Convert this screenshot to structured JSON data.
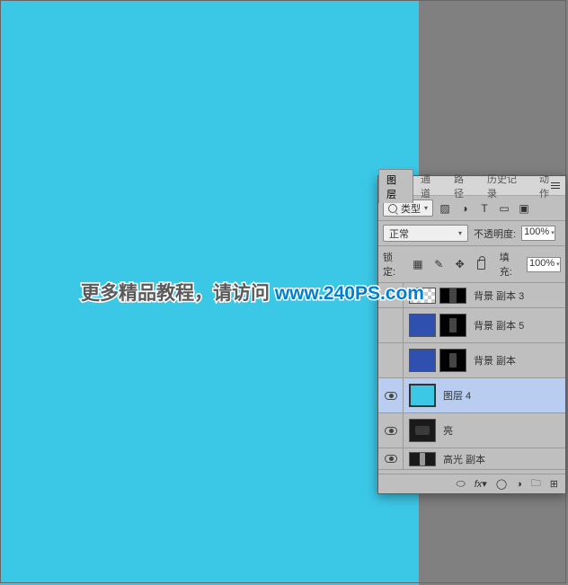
{
  "watermark": {
    "text1": "更多精品教程，请访问 ",
    "url": "www.240PS.com"
  },
  "panel": {
    "tabs": [
      "图层",
      "通道",
      "路径",
      "历史记录",
      "动作"
    ],
    "active_tab": 0,
    "filter": {
      "kind": "类型"
    },
    "blend": {
      "mode": "正常",
      "opacity_label": "不透明度:",
      "opacity_value": "100%"
    },
    "lock": {
      "label": "锁定:",
      "fill_label": "填充:",
      "fill_value": "100%"
    },
    "layers": [
      {
        "name": "背景 副本 3",
        "visible": false,
        "thumbs": [
          "checker",
          "mask1"
        ]
      },
      {
        "name": "背景 副本 5",
        "visible": false,
        "thumbs": [
          "blue",
          "mask1"
        ]
      },
      {
        "name": "背景 副本",
        "visible": false,
        "thumbs": [
          "blue",
          "mask1"
        ]
      },
      {
        "name": "图层 4",
        "visible": true,
        "thumbs": [
          "cyan"
        ],
        "selected": true
      },
      {
        "name": "亮",
        "visible": true,
        "thumbs": [
          "dark2"
        ]
      },
      {
        "name": "高光 副本",
        "visible": true,
        "thumbs": [
          "dark3"
        ]
      }
    ]
  }
}
